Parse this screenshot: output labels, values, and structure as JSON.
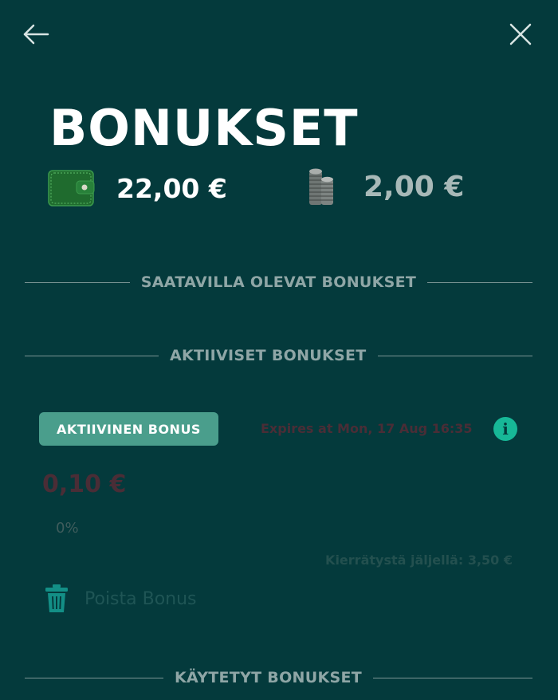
{
  "header": {
    "title": "BONUKSET",
    "back_icon": "arrow-left-icon",
    "close_icon": "close-icon"
  },
  "balances": {
    "main_balance": "22,00 €",
    "main_icon": "wallet-icon",
    "bonus_balance": "2,00 €",
    "bonus_icon": "coins-icon"
  },
  "sections": {
    "available": "SAATAVILLA OLEVAT BONUKSET",
    "active": "AKTIIVISET BONUKSET",
    "used": "KÄYTETYT BONUKSET"
  },
  "active_bonus": {
    "badge": "AKTIIVINEN BONUS",
    "expires": "Expires at Mon, 17 Aug 16:35",
    "info_icon_glyph": "i",
    "amount": "0,10 €",
    "progress_label": "0%",
    "progress_value": 0,
    "wagering_remaining": "Kierrätystä jäljellä: 3,50 €",
    "remove_label": "Poista Bonus",
    "remove_icon": "trash-icon"
  },
  "colors": {
    "background": "#043a3c",
    "accent": "#4a9e8c",
    "info": "#17b897"
  }
}
